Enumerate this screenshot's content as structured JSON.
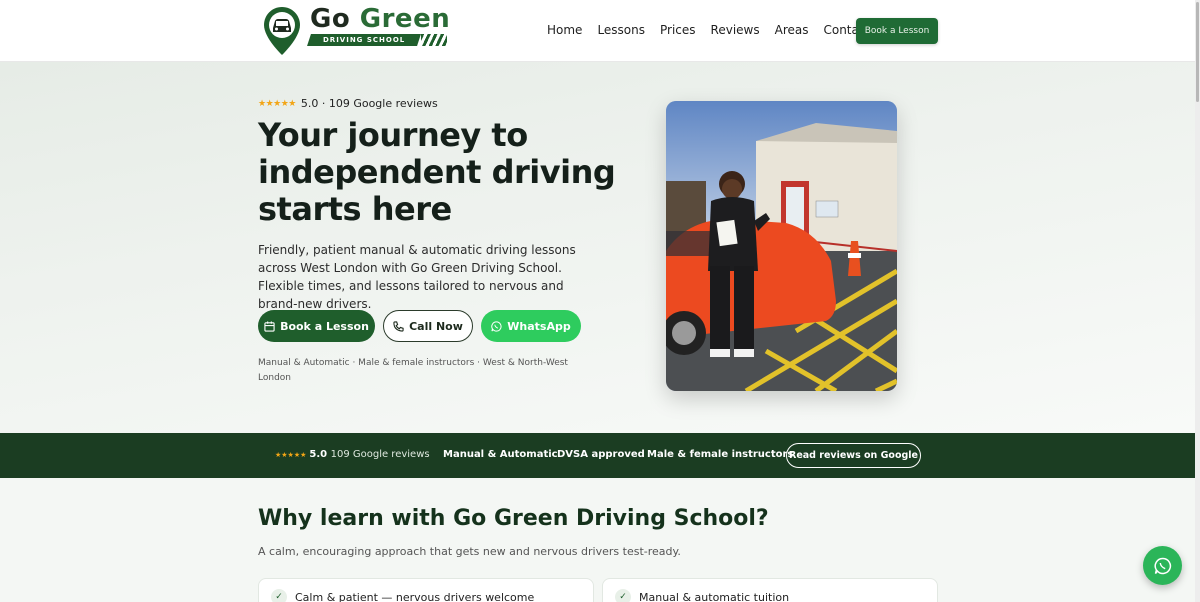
{
  "brand": {
    "name_part1": "Go",
    "name_part2": "Green",
    "tagline": "DRIVING SCHOOL"
  },
  "nav": {
    "items": [
      {
        "label": "Home"
      },
      {
        "label": "Lessons"
      },
      {
        "label": "Prices"
      },
      {
        "label": "Reviews"
      },
      {
        "label": "Areas"
      },
      {
        "label": "Contact"
      }
    ],
    "cta_label": "Book a Lesson"
  },
  "hero": {
    "rating_stars": "★★★★★",
    "rating_text": "5.0 · 109 Google reviews",
    "title": "Your journey to independent driving starts here",
    "description": "Friendly, patient manual & automatic driving lessons across West London with Go Green Driving School. Flexible times, and lessons tailored to nervous and brand-new drivers.",
    "buttons": {
      "book": "Book a Lesson",
      "call": "Call Now",
      "whatsapp": "WhatsApp"
    },
    "note": "Manual & Automatic · Male & female instructors · West & North-West London"
  },
  "stats_bar": {
    "rating_stars": "★★★★★",
    "rating_value": "5.0",
    "rating_label": "109 Google reviews",
    "items": [
      "Manual & Automatic",
      "DVSA approved",
      "Male & female instructors"
    ],
    "button_label": "Read reviews on Google"
  },
  "why": {
    "title": "Why learn with Go Green Driving School?",
    "subtitle": "A calm, encouraging approach that gets new and nervous drivers test-ready.",
    "cards": [
      {
        "label": "Calm & patient — nervous drivers welcome"
      },
      {
        "label": "Manual & automatic tuition"
      }
    ]
  },
  "colors": {
    "brand_green": "#1f5e2c",
    "dark_green_bar": "#1b3d22",
    "whatsapp_green": "#2ecc5e",
    "star_gold": "#f2a516"
  },
  "icons": {
    "book": "calendar-icon",
    "call": "phone-icon",
    "whatsapp": "whatsapp-icon",
    "check": "check-icon",
    "logo": "car-pin-icon"
  }
}
